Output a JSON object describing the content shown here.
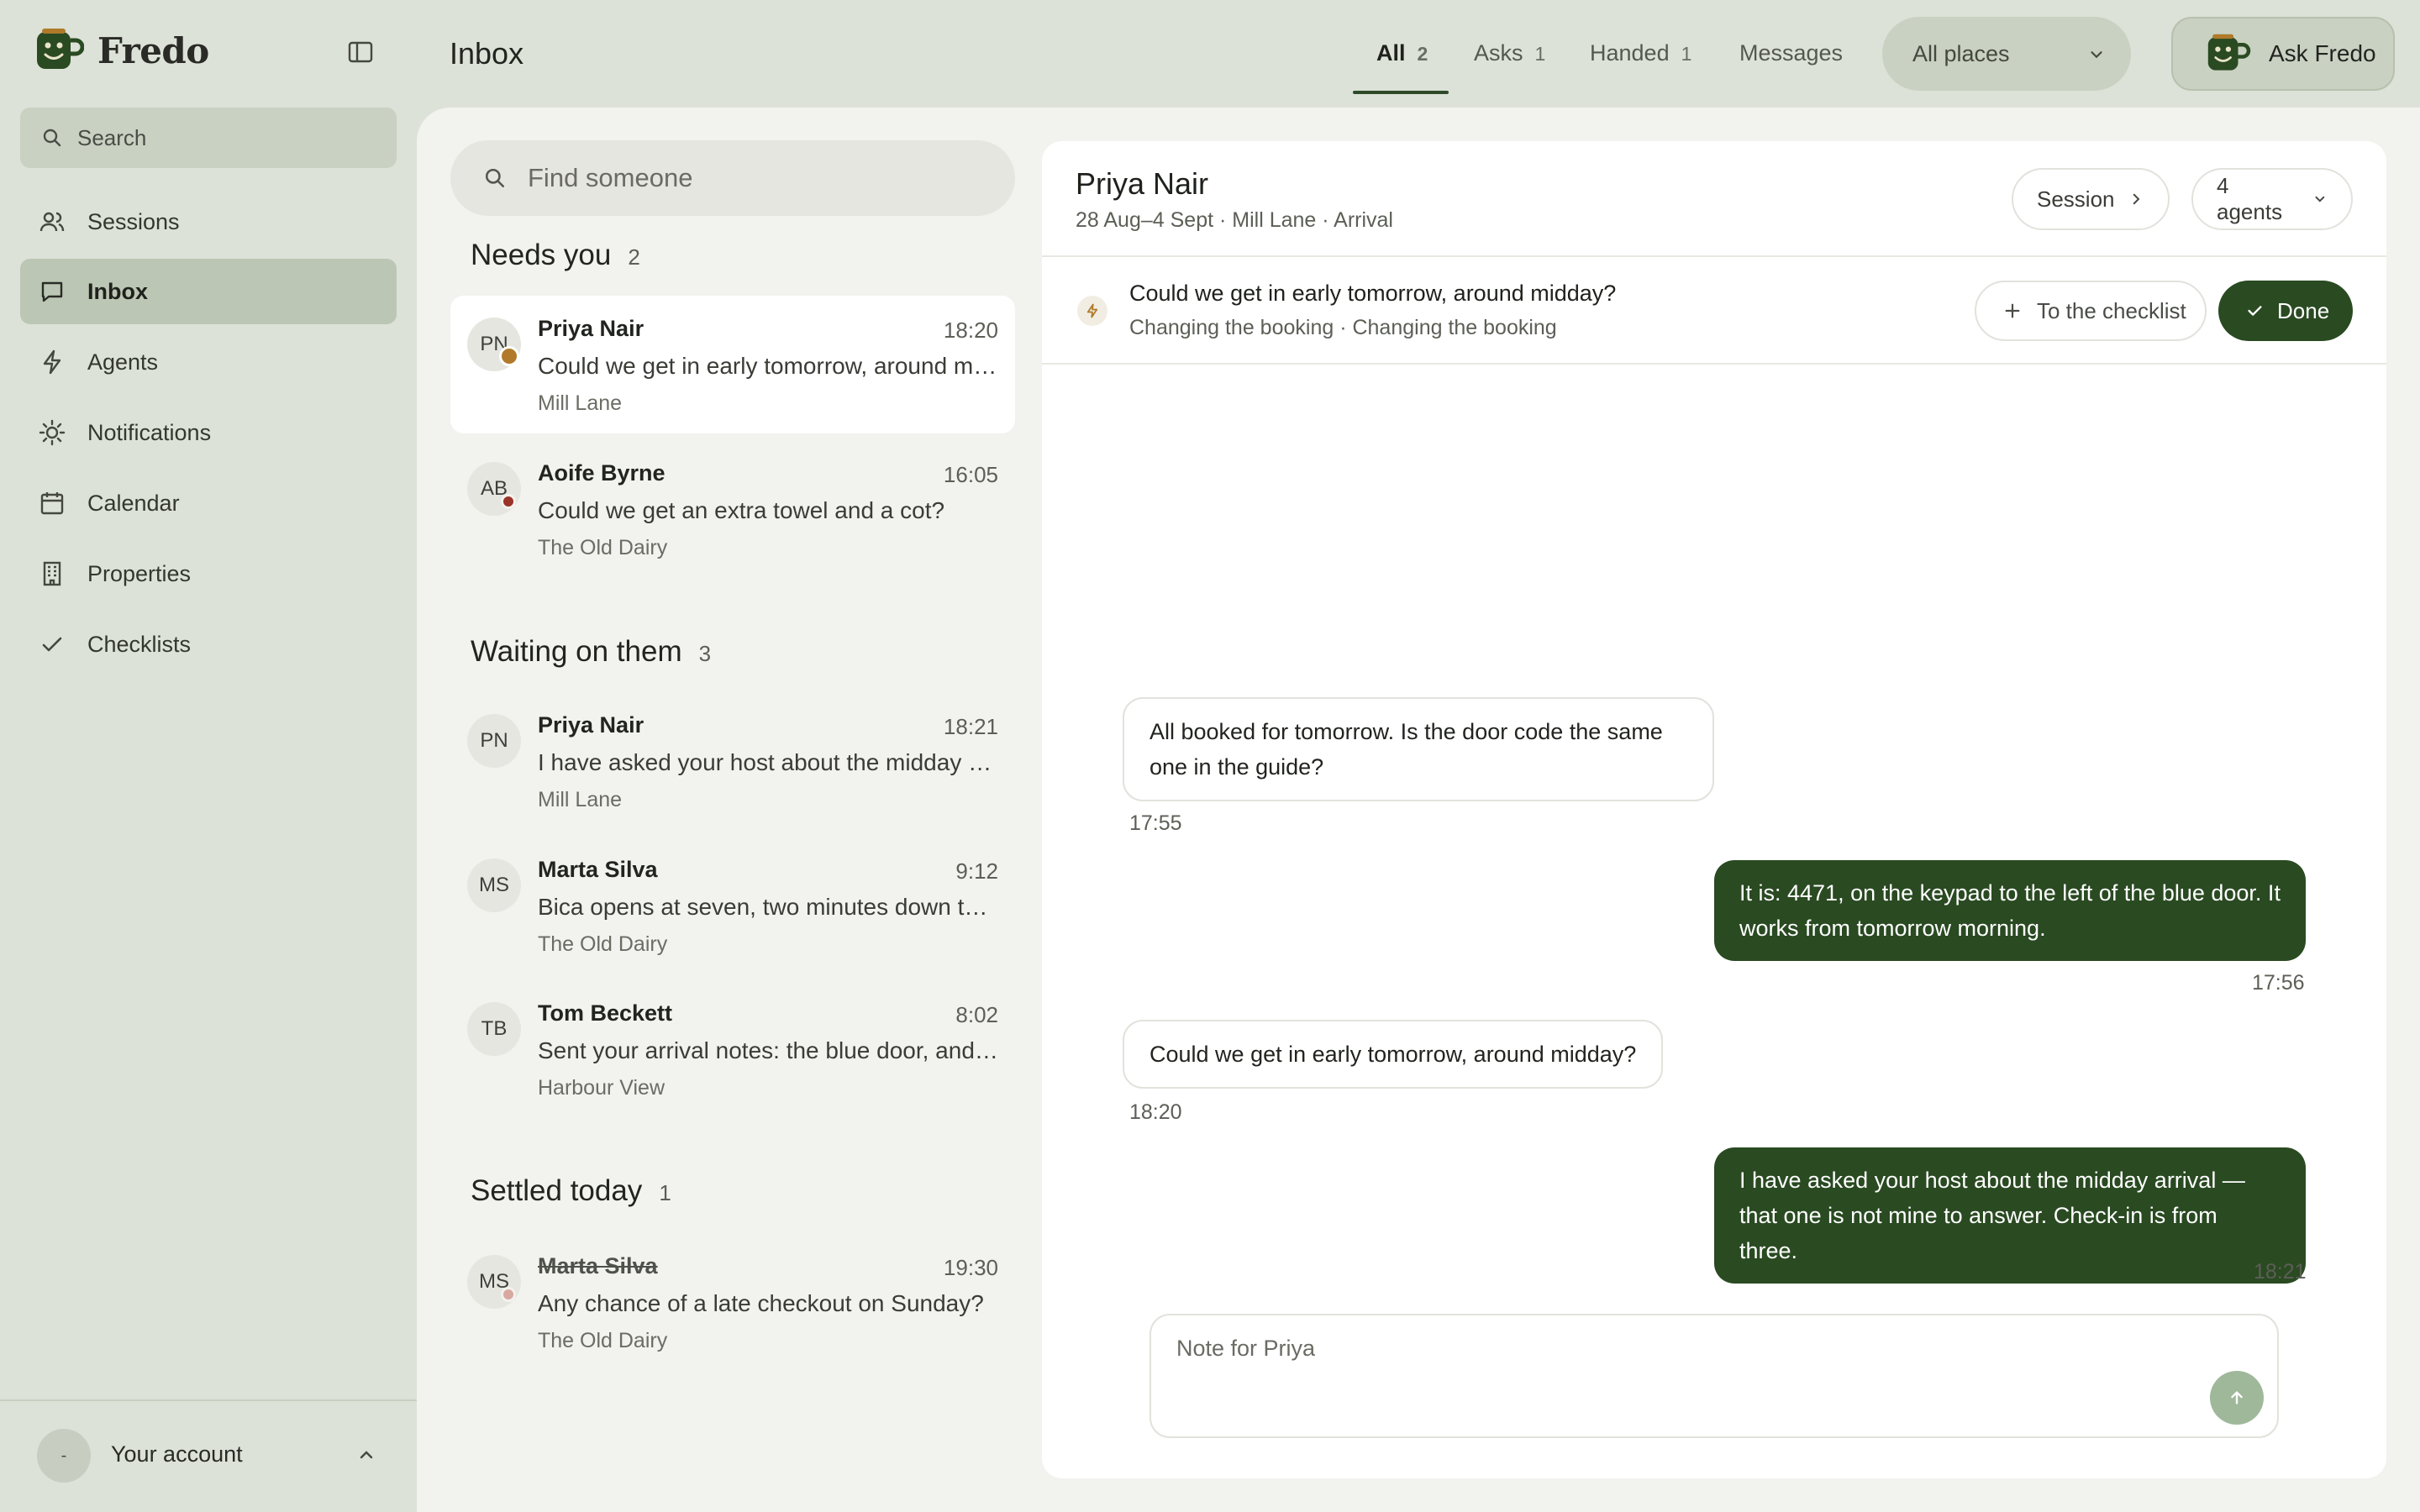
{
  "app": {
    "name": "Fredo",
    "page_title": "Inbox"
  },
  "sidebar": {
    "search_placeholder": "Search",
    "items": [
      {
        "label": "Sessions",
        "icon": "users-icon"
      },
      {
        "label": "Inbox",
        "icon": "chat-icon",
        "active": true
      },
      {
        "label": "Agents",
        "icon": "bolt-icon"
      },
      {
        "label": "Notifications",
        "icon": "sun-icon"
      },
      {
        "label": "Calendar",
        "icon": "calendar-icon"
      },
      {
        "label": "Properties",
        "icon": "building-icon"
      },
      {
        "label": "Checklists",
        "icon": "check-icon"
      }
    ],
    "account": {
      "avatar": "-",
      "label": "Your account"
    }
  },
  "top_tabs": [
    {
      "label": "All",
      "count": "2",
      "active": true
    },
    {
      "label": "Asks",
      "count": "1"
    },
    {
      "label": "Handed",
      "count": "1"
    },
    {
      "label": "Messages",
      "count": ""
    }
  ],
  "place_filter": {
    "value": "All places"
  },
  "ask_button": {
    "label": "Ask Fredo"
  },
  "inbox_list": {
    "search_placeholder": "Find someone",
    "sections": [
      {
        "title": "Needs you",
        "count": "2",
        "items": [
          {
            "initials": "PN",
            "name": "Priya Nair",
            "time": "18:20",
            "snippet": "Could we get in early tomorrow, around midday?",
            "place": "Mill Lane",
            "badge_color": "#b07a2a",
            "selected": true
          },
          {
            "initials": "AB",
            "name": "Aoife Byrne",
            "time": "16:05",
            "snippet": "Could we get an extra towel and a cot?",
            "place": "The Old Dairy",
            "badge_color": "#9a3328"
          }
        ]
      },
      {
        "title": "Waiting on them",
        "count": "3",
        "items": [
          {
            "initials": "PN",
            "name": "Priya Nair",
            "time": "18:21",
            "snippet": "I have asked your host about the midday arrival — that one is not mine to answer.",
            "place": "Mill Lane"
          },
          {
            "initials": "MS",
            "name": "Marta Silva",
            "time": "9:12",
            "snippet": "Bica opens at seven, two minutes down the hill.",
            "place": "The Old Dairy"
          },
          {
            "initials": "TB",
            "name": "Tom Beckett",
            "time": "8:02",
            "snippet": "Sent your arrival notes: the blue door, and the keypad.",
            "place": "Harbour View"
          }
        ]
      },
      {
        "title": "Settled today",
        "count": "1",
        "items": [
          {
            "initials": "MS",
            "name": "Marta Silva",
            "time": "19:30",
            "snippet": "Any chance of a late checkout on Sunday?",
            "place": "The Old Dairy",
            "badge_color": "#d8a8a0",
            "struck": true
          }
        ]
      }
    ]
  },
  "thread": {
    "name": "Priya Nair",
    "meta": "28 Aug–4 Sept · Mill Lane · Arrival",
    "session_button": "Session",
    "agents_button": "4 agents",
    "ask": {
      "question": "Could we get in early tomorrow, around midday?",
      "sub": "Changing the booking · Changing the booking",
      "checklist_button": "To the checklist",
      "done_button": "Done"
    },
    "messages": [
      {
        "direction": "in",
        "text": "All booked for tomorrow. Is the door code the same one in the guide?",
        "time": "17:55"
      },
      {
        "direction": "out",
        "text": "It is: 4471, on the keypad to the left of the blue door. It works from tomorrow morning.",
        "time": "17:56"
      },
      {
        "direction": "in",
        "text": "Could we get in early tomorrow, around midday?",
        "time": "18:20"
      },
      {
        "direction": "out",
        "text": "I have asked your host about the midday arrival — that one is not mine to answer. Check-in is from three.",
        "time": "18:21"
      }
    ],
    "note_placeholder": "Note for Priya"
  },
  "colors": {
    "sidebar_bg": "#dce2d7",
    "panel_bg": "#f2f2ee",
    "accent_green": "#2a4a22",
    "ask_bolt": "#b07a2a"
  }
}
